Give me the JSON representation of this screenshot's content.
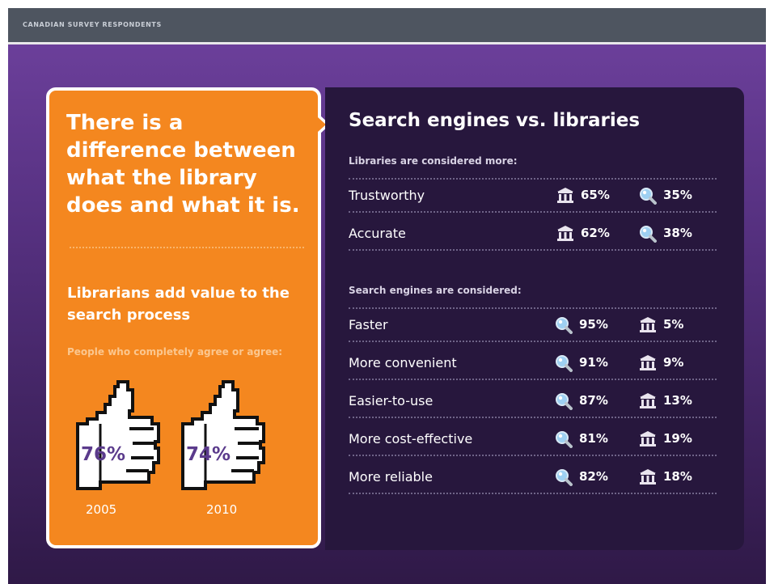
{
  "header": {
    "title": "CANADIAN SURVEY RESPONDENTS"
  },
  "left_card": {
    "headline": "There is a difference between what the library does and what it is.",
    "subheadline": "Librarians add value to the search process",
    "caption": "People who completely agree or agree:"
  },
  "colors": {
    "orange": "#f4871f",
    "purple_background": "#5a3485",
    "dark_panel": "#27173d",
    "percent_text": "#5b3b8c"
  },
  "icons": {
    "library": "library-building-icon",
    "search_engine": "magnifying-glass-icon",
    "thumb": "thumbs-up-icon"
  },
  "chart_data": [
    {
      "type": "table",
      "title": "Search engines vs. libraries",
      "sections": [
        {
          "label": "Libraries are considered more:",
          "rows": [
            {
              "label": "Trustworthy",
              "library": "65%",
              "search_engine": "35%"
            },
            {
              "label": "Accurate",
              "library": "62%",
              "search_engine": "38%"
            }
          ]
        },
        {
          "label": "Search engines are considered:",
          "rows": [
            {
              "label": "Faster",
              "search_engine": "95%",
              "library": "5%"
            },
            {
              "label": "More convenient",
              "search_engine": "91%",
              "library": "9%"
            },
            {
              "label": "Easier-to-use",
              "search_engine": "87%",
              "library": "13%"
            },
            {
              "label": "More cost-effective",
              "search_engine": "81%",
              "library": "19%"
            },
            {
              "label": "More reliable",
              "search_engine": "82%",
              "library": "18%"
            }
          ]
        }
      ]
    },
    {
      "type": "bar",
      "categories": [
        "2005",
        "2010"
      ],
      "values": [
        76,
        74
      ],
      "labels": [
        "76%",
        "74%"
      ]
    }
  ]
}
